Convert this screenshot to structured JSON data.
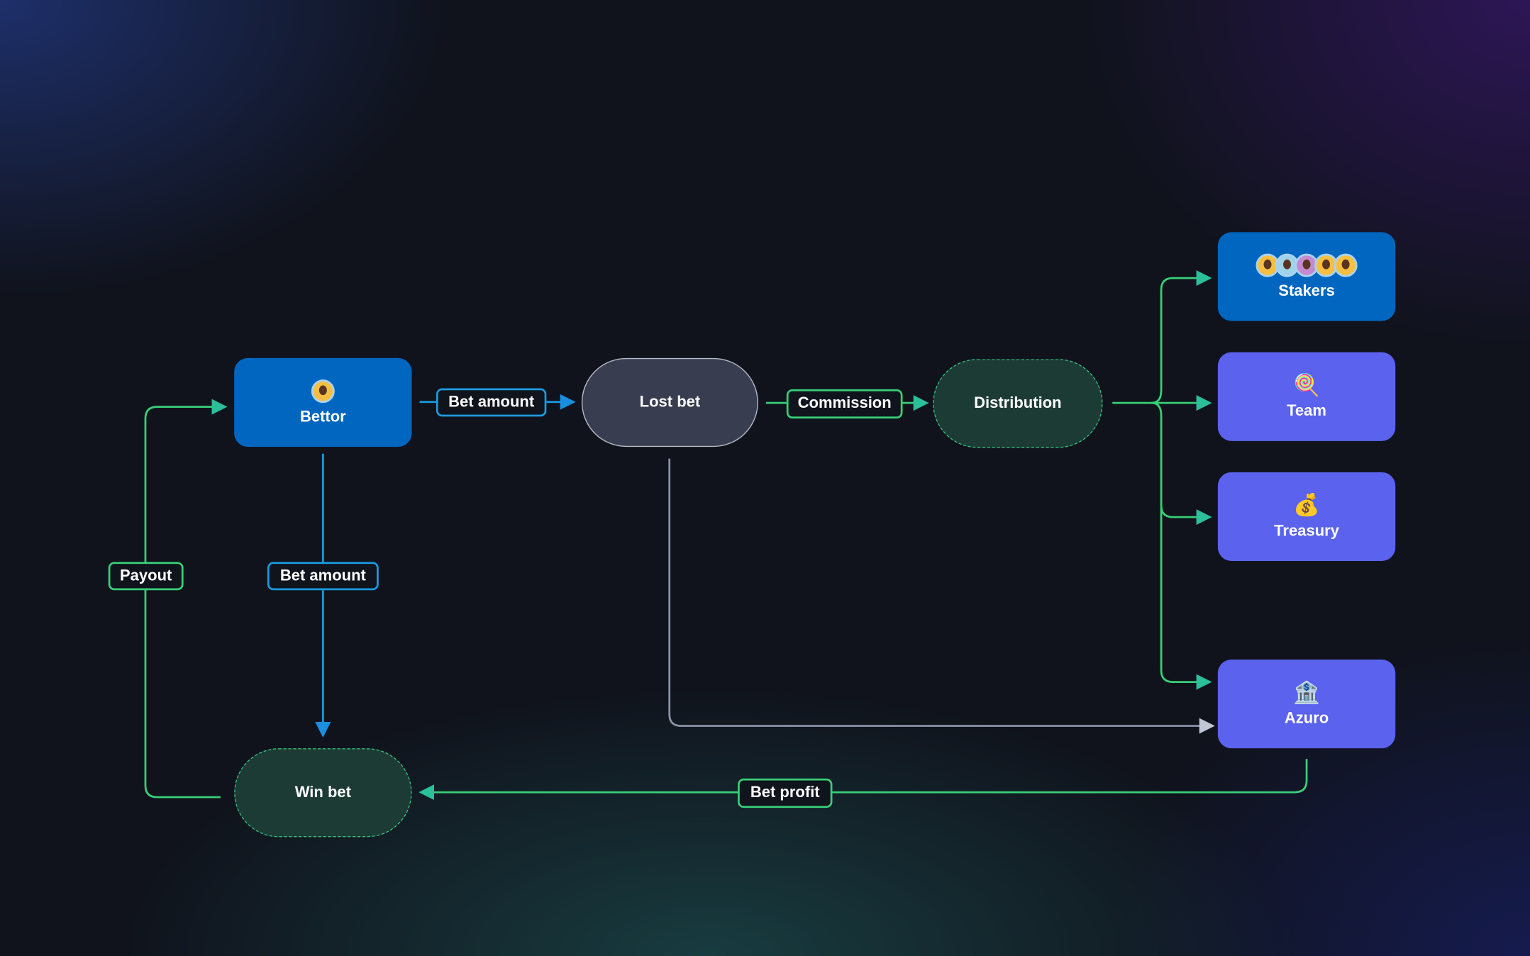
{
  "nodes": {
    "bettor": {
      "label": "Bettor",
      "icon": "avatar"
    },
    "lost_bet": {
      "label": "Lost bet"
    },
    "distribution": {
      "label": "Distribution"
    },
    "win_bet": {
      "label": "Win bet"
    },
    "stakers": {
      "label": "Stakers",
      "icon": "avatar-group"
    },
    "team": {
      "label": "Team",
      "icon": "🍭"
    },
    "treasury": {
      "label": "Treasury",
      "icon": "💰"
    },
    "azuro": {
      "label": "Azuro",
      "icon": "🏦"
    }
  },
  "edges": {
    "bet_amount_right": "Bet amount",
    "bet_amount_down": "Bet amount",
    "commission": "Commission",
    "payout": "Payout",
    "bet_profit": "Bet profit"
  },
  "colors": {
    "blue_node": "#0066bf",
    "violet_node": "#5a62ee",
    "lost_node": "#383d50",
    "green_edge": "#38cf78",
    "blue_edge": "#1a9be0",
    "gray_edge": "#8a93a6",
    "avatars": [
      "#f5c042",
      "#9fd3ea",
      "#c58ad0",
      "#f5c042",
      "#f5c042"
    ]
  }
}
